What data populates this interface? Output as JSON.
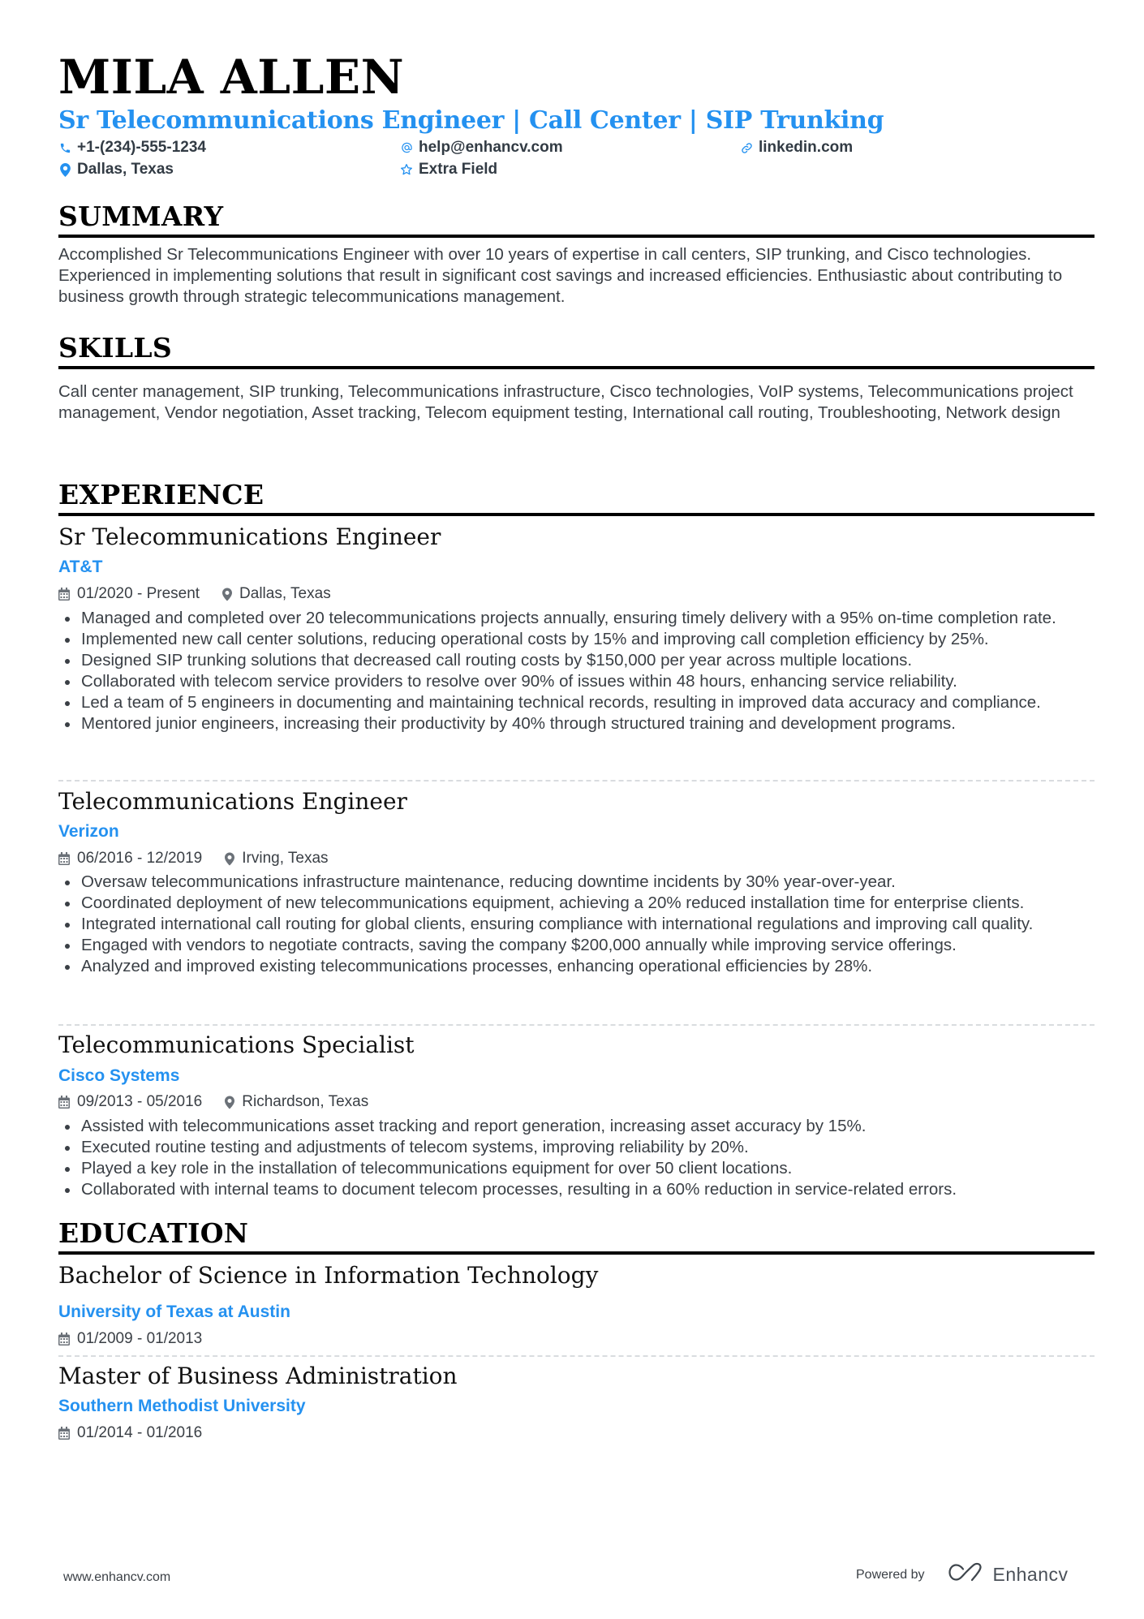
{
  "header": {
    "name": "MILA ALLEN",
    "headline": "Sr Telecommunications Engineer | Call Center | SIP Trunking",
    "contacts": {
      "phone": "+1-(234)-555-1234",
      "email": "help@enhancv.com",
      "linkedin": "linkedin.com",
      "location": "Dallas, Texas",
      "extra": "Extra Field"
    }
  },
  "colors": {
    "accent": "#2491f0",
    "text": "#3a3f45",
    "heading": "#000000"
  },
  "summary": {
    "title": "SUMMARY",
    "text": "Accomplished Sr Telecommunications Engineer with over 10 years of expertise in call centers, SIP trunking, and Cisco technologies. Experienced in implementing solutions that result in significant cost savings and increased efficiencies. Enthusiastic about contributing to business growth through strategic telecommunications management."
  },
  "skills": {
    "title": "SKILLS",
    "text": "Call center management, SIP trunking, Telecommunications infrastructure, Cisco technologies, VoIP systems, Telecommunications project management, Vendor negotiation, Asset tracking, Telecom equipment testing, International call routing, Troubleshooting, Network design"
  },
  "experience": {
    "title": "EXPERIENCE",
    "jobs": [
      {
        "role": "Sr Telecommunications Engineer",
        "company": "AT&T",
        "dates": "01/2020 - Present",
        "location": "Dallas, Texas",
        "bullets": [
          "Managed and completed over 20 telecommunications projects annually, ensuring timely delivery with a 95% on-time completion rate.",
          "Implemented new call center solutions, reducing operational costs by 15% and improving call completion efficiency by 25%.",
          "Designed SIP trunking solutions that decreased call routing costs by $150,000 per year across multiple locations.",
          "Collaborated with telecom service providers to resolve over 90% of issues within 48 hours, enhancing service reliability.",
          "Led a team of 5 engineers in documenting and maintaining technical records, resulting in improved data accuracy and compliance.",
          "Mentored junior engineers, increasing their productivity by 40% through structured training and development programs."
        ]
      },
      {
        "role": "Telecommunications Engineer",
        "company": "Verizon",
        "dates": "06/2016 - 12/2019",
        "location": "Irving, Texas",
        "bullets": [
          "Oversaw telecommunications infrastructure maintenance, reducing downtime incidents by 30% year-over-year.",
          "Coordinated deployment of new telecommunications equipment, achieving a 20% reduced installation time for enterprise clients.",
          "Integrated international call routing for global clients, ensuring compliance with international regulations and improving call quality.",
          "Engaged with vendors to negotiate contracts, saving the company $200,000 annually while improving service offerings.",
          "Analyzed and improved existing telecommunications processes, enhancing operational efficiencies by 28%."
        ]
      },
      {
        "role": "Telecommunications Specialist",
        "company": "Cisco Systems",
        "dates": "09/2013 - 05/2016",
        "location": "Richardson, Texas",
        "bullets": [
          "Assisted with telecommunications asset tracking and report generation, increasing asset accuracy by 15%.",
          "Executed routine testing and adjustments of telecom systems, improving reliability by 20%.",
          "Played a key role in the installation of telecommunications equipment for over 50 client locations.",
          "Collaborated with internal teams to document telecom processes, resulting in a 60% reduction in service-related errors."
        ]
      }
    ]
  },
  "education": {
    "title": "EDUCATION",
    "items": [
      {
        "degree": "Bachelor of Science in Information Technology",
        "school": "University of Texas at Austin",
        "dates": "01/2009 - 01/2013"
      },
      {
        "degree": "Master of Business Administration",
        "school": "Southern Methodist University",
        "dates": "01/2014 - 01/2016"
      }
    ]
  },
  "footer": {
    "website": "www.enhancv.com",
    "powered_by": "Powered by",
    "brand": "Enhancv"
  },
  "icons": {
    "phone": "phone-icon",
    "email": "at-icon",
    "linkedin": "link-icon",
    "location": "map-pin-icon",
    "extra": "star-icon",
    "calendar": "calendar-icon"
  }
}
